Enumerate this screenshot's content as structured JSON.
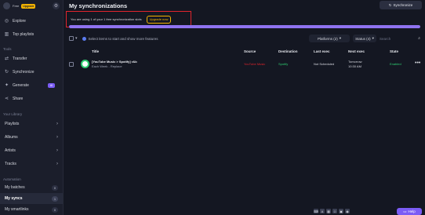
{
  "sidebar": {
    "plan_free": "Free",
    "plan_upgrade": "Upgrade",
    "nav": [
      {
        "label": "Explore",
        "icon": "compass-icon"
      },
      {
        "label": "Top playlists",
        "icon": "chart-icon"
      }
    ],
    "tools_title": "Tools",
    "tools": [
      {
        "label": "Transfer",
        "icon": "transfer-icon"
      },
      {
        "label": "Synchronize",
        "icon": "sync-icon"
      },
      {
        "label": "Generate",
        "icon": "sparkle-icon",
        "badge": "AI"
      },
      {
        "label": "Share",
        "icon": "share-icon"
      }
    ],
    "library_title": "Your Library",
    "library": [
      "Playlists",
      "Albums",
      "Artists",
      "Tracks"
    ],
    "automation_title": "Automation",
    "automation": [
      {
        "label": "My batches",
        "count": "0"
      },
      {
        "label": "My syncs",
        "count": "1"
      },
      {
        "label": "My smartlinks",
        "count": "0"
      }
    ]
  },
  "header": {
    "title": "My synchronizations",
    "sync_button": "Synchronize"
  },
  "banner": {
    "text": "You are using 1 of your 1 free synchronization slots",
    "button": "Upgrade now"
  },
  "progress_fraction": 1.0,
  "toolbar": {
    "hint": "Select items to start and show more features",
    "platforms": "Platforms (2)",
    "status": "Status (4)",
    "search_placeholder": "Search"
  },
  "table": {
    "headers": [
      "Title",
      "Source",
      "Destination",
      "Last exec",
      "Next exec",
      "State"
    ],
    "rows": [
      {
        "title": "[YouTube Music > Spotify] r&b",
        "subtitle": "Each Week - Replace",
        "source": "YouTube Music",
        "destination": "Spotify",
        "last_exec": "Not Scheduled",
        "next_exec_1": "Tomorrow",
        "next_exec_2": "10:30 AM",
        "state": "Enabled"
      }
    ]
  },
  "footer": {
    "help": "Help"
  },
  "colors": {
    "accent": "#8f73f0",
    "warning": "#f5b400",
    "highlight": "#e0242c",
    "success": "#2ecc71"
  }
}
